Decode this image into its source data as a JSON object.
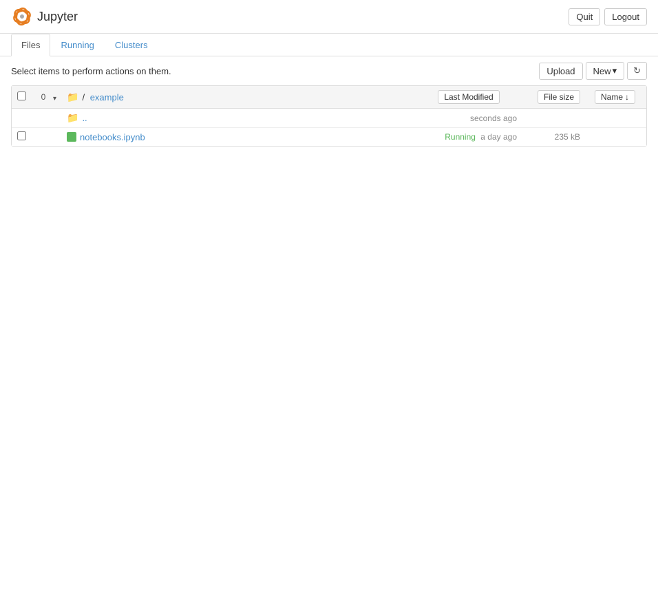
{
  "header": {
    "title": "Jupyter",
    "quit_label": "Quit",
    "logout_label": "Logout"
  },
  "tabs": [
    {
      "id": "files",
      "label": "Files",
      "active": true
    },
    {
      "id": "running",
      "label": "Running",
      "active": false
    },
    {
      "id": "clusters",
      "label": "Clusters",
      "active": false
    }
  ],
  "toolbar": {
    "select_info": "Select items to perform actions on them.",
    "upload_label": "Upload",
    "new_label": "New",
    "new_caret": "▾",
    "refresh_icon": "↻",
    "selected_count": "0"
  },
  "file_list": {
    "breadcrumb_path": "/",
    "breadcrumb_folder": "example",
    "breadcrumb_separator": "/",
    "columns": {
      "name_label": "Name",
      "name_sort_icon": "↓",
      "modified_label": "Last Modified",
      "size_label": "File size"
    },
    "rows": [
      {
        "type": "parent",
        "name": "..",
        "modified": "seconds ago",
        "size": "",
        "running": false,
        "icon": "folder"
      },
      {
        "type": "notebook",
        "name": "notebooks.ipynb",
        "modified": "a day ago",
        "size": "235 kB",
        "running": true,
        "running_label": "Running",
        "icon": "notebook"
      }
    ]
  }
}
